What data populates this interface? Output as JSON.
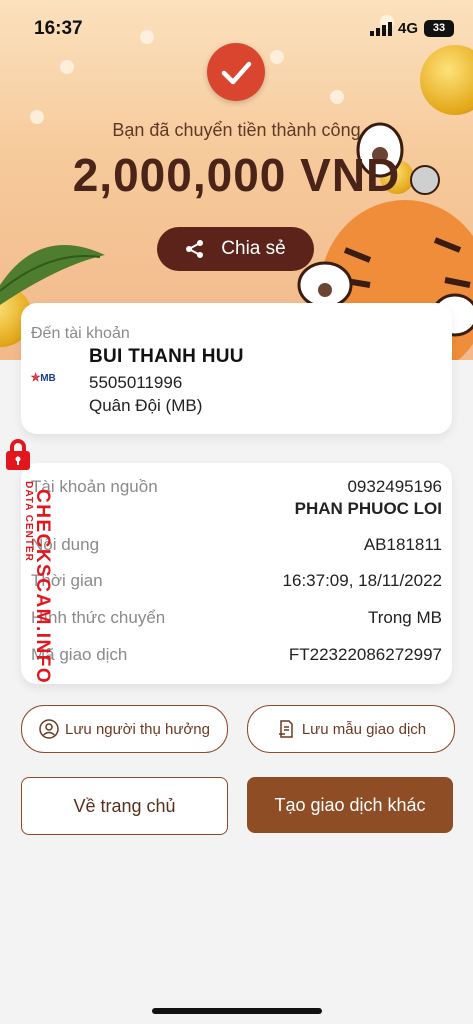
{
  "status_bar": {
    "time": "16:37",
    "network": "4G",
    "battery": "33"
  },
  "header": {
    "subtitle": "Bạn đã chuyển tiền thành công",
    "amount": "2,000,000 VND",
    "share_label": "Chia sẻ"
  },
  "recipient": {
    "label": "Đến tài khoản",
    "bank_logo": "MB",
    "name": "BUI THANH HUU",
    "account": "5505011996",
    "bank": "Quân Đội (MB)"
  },
  "details": {
    "source_label": "Tài khoản nguồn",
    "source_account": "0932495196",
    "source_name": "PHAN PHUOC LOI",
    "content_label": "Nội dung",
    "content_value": "AB181811",
    "time_label": "Thời gian",
    "time_value": "16:37:09, 18/11/2022",
    "method_label": "Hình thức chuyển",
    "method_value": "Trong MB",
    "txn_label": "Mã giao dịch",
    "txn_value": "FT22322086272997"
  },
  "actions": {
    "save_beneficiary": "Lưu người thụ hưởng",
    "save_template": "Lưu mẫu giao dịch",
    "home": "Về trang chủ",
    "new_transaction": "Tạo giao dịch khác"
  },
  "watermark": {
    "main": "CHECKSCAM.INFO",
    "sub": "DATA CENTER"
  },
  "colors": {
    "accent": "#8e4d24",
    "share_bg": "#5b231a",
    "success": "#d9452f",
    "watermark": "#e3161e"
  },
  "icons": [
    "signal-icon",
    "checkmark-icon",
    "share-icon",
    "person-icon",
    "document-icon",
    "lock-icon"
  ]
}
